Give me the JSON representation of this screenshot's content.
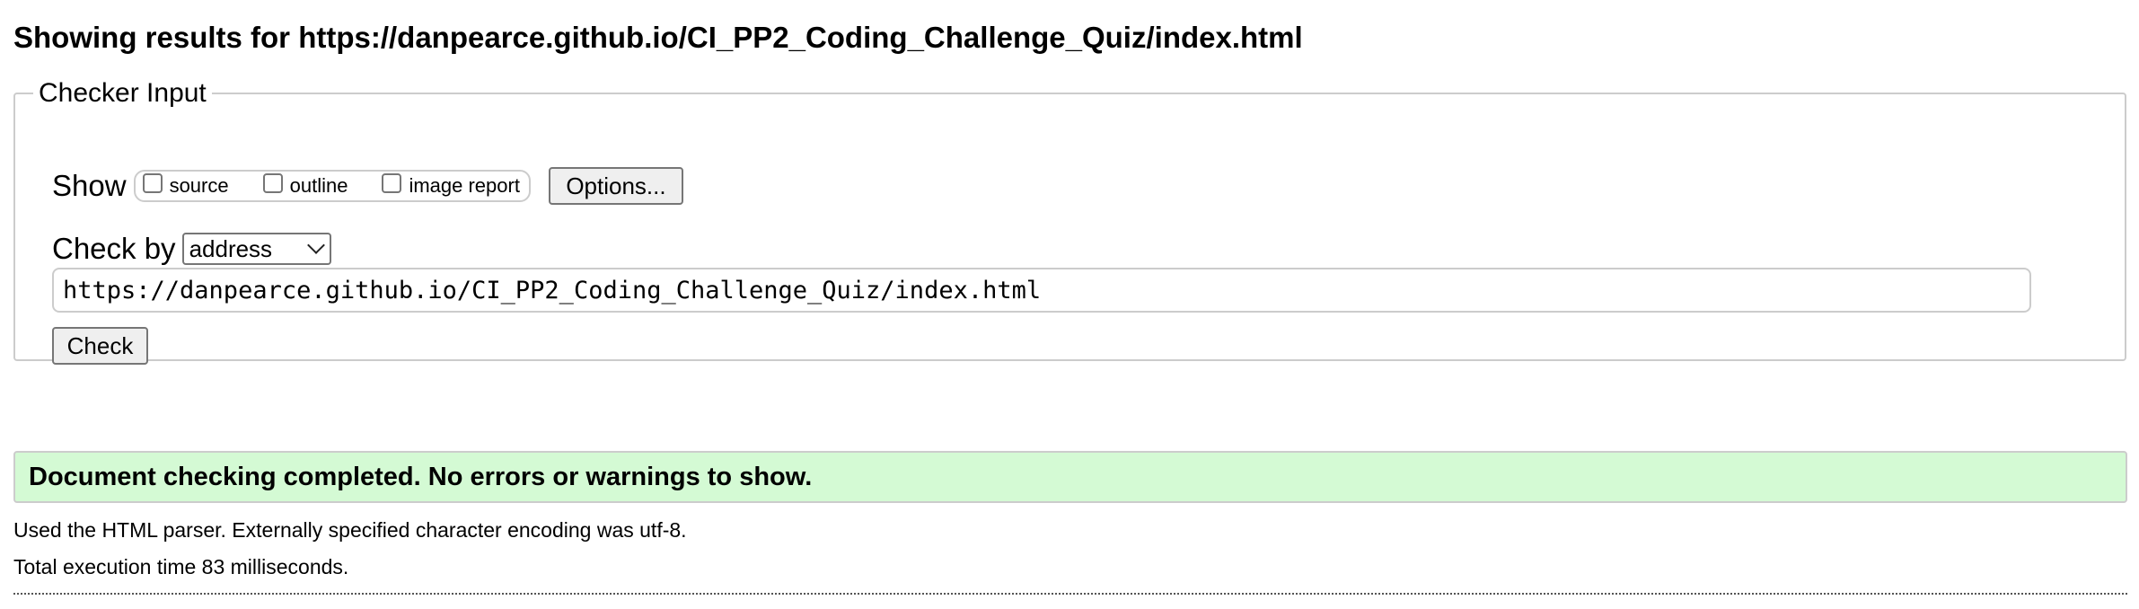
{
  "header": {
    "title": "Showing results for https://danpearce.github.io/CI_PP2_Coding_Challenge_Quiz/index.html"
  },
  "checker": {
    "legend": "Checker Input",
    "show_label": "Show",
    "show_options": [
      {
        "label": "source",
        "checked": false
      },
      {
        "label": "outline",
        "checked": false
      },
      {
        "label": "image report",
        "checked": false
      }
    ],
    "options_button": "Options...",
    "check_by_label": "Check by",
    "check_by_selected": "address",
    "url_value": "https://danpearce.github.io/CI_PP2_Coding_Challenge_Quiz/index.html",
    "check_button": "Check"
  },
  "result": {
    "message": "Document checking completed. No errors or warnings to show.",
    "bg_color": "#d4fad4"
  },
  "info": {
    "parser": "Used the HTML parser. Externally specified character encoding was utf-8.",
    "time": "Total execution time 83 milliseconds."
  }
}
